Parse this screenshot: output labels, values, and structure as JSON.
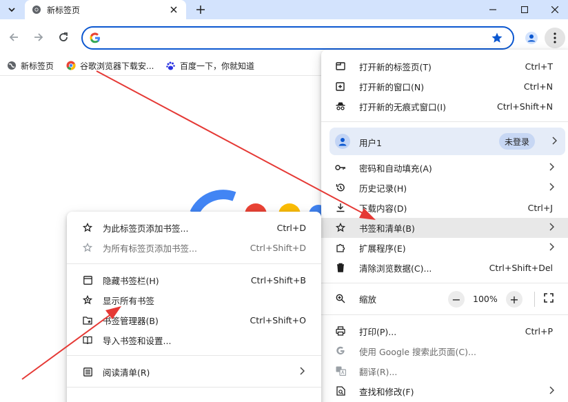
{
  "tab": {
    "title": "新标签页"
  },
  "omnibox": {
    "value": ""
  },
  "bookmarks": [
    {
      "label": "新标签页",
      "icon": "globe-icon"
    },
    {
      "label": "谷歌浏览器下载安...",
      "icon": "chrome-icon"
    },
    {
      "label": "百度一下，你就知道",
      "icon": "baidu-paw-icon"
    }
  ],
  "main_menu": {
    "new_tab": {
      "label": "打开新的标签页(T)",
      "shortcut": "Ctrl+T"
    },
    "new_window": {
      "label": "打开新的窗口(N)",
      "shortcut": "Ctrl+N"
    },
    "incognito": {
      "label": "打开新的无痕式窗口(I)",
      "shortcut": "Ctrl+Shift+N"
    },
    "profile": {
      "label": "用户1",
      "badge": "未登录"
    },
    "passwords": {
      "label": "密码和自动填充(A)"
    },
    "history": {
      "label": "历史记录(H)"
    },
    "downloads": {
      "label": "下载内容(D)",
      "shortcut": "Ctrl+J"
    },
    "bookmarks": {
      "label": "书签和清单(B)"
    },
    "extensions": {
      "label": "扩展程序(E)"
    },
    "clear_data": {
      "label": "清除浏览数据(C)...",
      "shortcut": "Ctrl+Shift+Del"
    },
    "zoom": {
      "label": "缩放",
      "minus": "−",
      "value": "100%",
      "plus": "+"
    },
    "print": {
      "label": "打印(P)...",
      "shortcut": "Ctrl+P"
    },
    "google_search": {
      "label": "使用 Google 搜索此页面(C)..."
    },
    "translate": {
      "label": "翻译(R)..."
    },
    "find": {
      "label": "查找和修改(F)"
    }
  },
  "sub_menu": {
    "bookmark_tab": {
      "label": "为此标签页添加书签...",
      "shortcut": "Ctrl+D"
    },
    "bookmark_all": {
      "label": "为所有标签页添加书签...",
      "shortcut": "Ctrl+Shift+D"
    },
    "hide_bar": {
      "label": "隐藏书签栏(H)",
      "shortcut": "Ctrl+Shift+B"
    },
    "show_all": {
      "label": "显示所有书签"
    },
    "manager": {
      "label": "书签管理器(B)",
      "shortcut": "Ctrl+Shift+O"
    },
    "import": {
      "label": "导入书签和设置..."
    },
    "reading_list": {
      "label": "阅读清单(R)"
    }
  },
  "colors": {
    "accent": "#0b57d0",
    "tabstrip": "#d3e3fd",
    "arrow": "#e53935"
  }
}
